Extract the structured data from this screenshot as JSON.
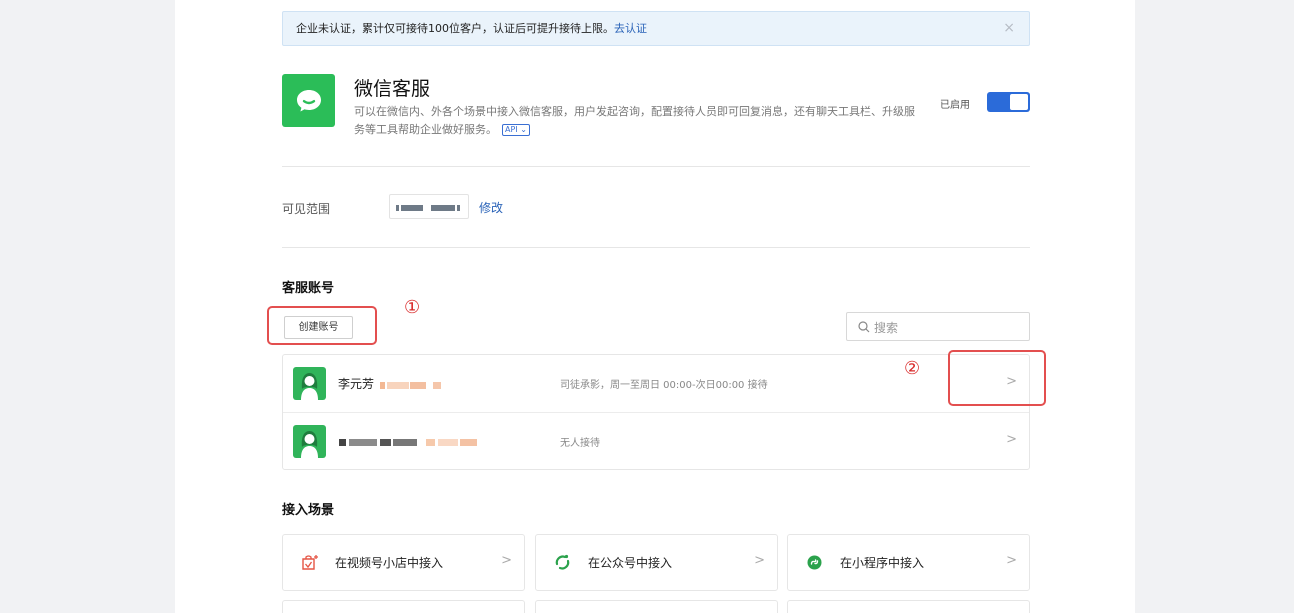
{
  "notice": {
    "text": "企业未认证，累计仅可接待100位客户，认证后可提升接待上限。",
    "link": "去认证",
    "close": "×"
  },
  "app": {
    "title": "微信客服",
    "description": "可以在微信内、外各个场景中接入微信客服，用户发起咨询，配置接待人员即可回复消息，还有聊天工具栏、升级服务等工具帮助企业做好服务。",
    "api_label": "API",
    "status_label": "已启用",
    "enabled": true,
    "brand_color": "#2bbd58",
    "toggle_color": "#2b6bd9"
  },
  "scope": {
    "label": "可见范围",
    "edit": "修改"
  },
  "accounts": {
    "section_title": "客服账号",
    "create_button": "创建账号",
    "search_placeholder": "搜索",
    "annotation_1": "①",
    "annotation_2": "②",
    "annotation_color": "#e34f4f",
    "rows": [
      {
        "name": "李元芳",
        "status": "司徒承影，周一至周日 00:00-次日00:00 接待",
        "chevron": ">"
      },
      {
        "name": "",
        "status": "无人接待",
        "chevron": ">"
      }
    ]
  },
  "scenes": {
    "section_title": "接入场景",
    "items": [
      {
        "label": "在视频号小店中接入",
        "icon": "video-shop-icon",
        "chevron": ">"
      },
      {
        "label": "在公众号中接入",
        "icon": "official-account-icon",
        "chevron": ">"
      },
      {
        "label": "在小程序中接入",
        "icon": "mini-program-icon",
        "chevron": ">"
      }
    ]
  }
}
